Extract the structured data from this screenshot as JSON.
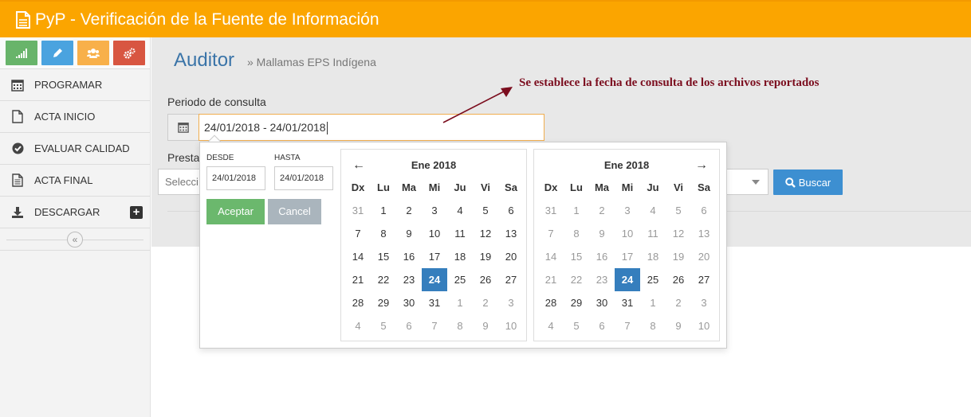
{
  "app": {
    "title": "PyP - Verificación de la Fuente de Información"
  },
  "sidebar": {
    "shortcuts": [
      {
        "icon": "signal-icon",
        "color": "#68b46a"
      },
      {
        "icon": "pencil-icon",
        "color": "#4aa3df"
      },
      {
        "icon": "users-icon",
        "color": "#f8b04a"
      },
      {
        "icon": "cogs-icon",
        "color": "#d85641"
      }
    ],
    "items": [
      {
        "label": "PROGRAMAR",
        "icon": "calendar-icon"
      },
      {
        "label": "ACTA INICIO",
        "icon": "file-icon"
      },
      {
        "label": "EVALUAR CALIDAD",
        "icon": "check-circle-icon"
      },
      {
        "label": "ACTA FINAL",
        "icon": "file-text-icon"
      },
      {
        "label": "DESCARGAR",
        "icon": "download-icon"
      }
    ],
    "collapse_glyph": "«"
  },
  "page": {
    "heading": "Auditor",
    "breadcrumb": "» Mallamas EPS Indígena",
    "period_label": "Periodo de consulta",
    "period_value": "24/01/2018 - 24/01/2018",
    "provider_label": "Presta",
    "provider_placeholder": "Selecci",
    "search_button": "Buscar"
  },
  "annotation": {
    "text": "Se establece la fecha de consulta de los archivos reportados",
    "color": "#7b0d1e"
  },
  "datepicker": {
    "from_label": "DESDE",
    "to_label": "HASTA",
    "from_value": "24/01/2018",
    "to_value": "24/01/2018",
    "apply_label": "Aceptar",
    "cancel_label": "Cancel",
    "weekdays": [
      "Dx",
      "Lu",
      "Ma",
      "Mi",
      "Ju",
      "Vi",
      "Sa"
    ],
    "calendars": [
      {
        "month": "Ene 2018",
        "days": [
          {
            "d": "31",
            "off": true
          },
          {
            "d": "1"
          },
          {
            "d": "2"
          },
          {
            "d": "3"
          },
          {
            "d": "4"
          },
          {
            "d": "5"
          },
          {
            "d": "6"
          },
          {
            "d": "7"
          },
          {
            "d": "8"
          },
          {
            "d": "9"
          },
          {
            "d": "10"
          },
          {
            "d": "11"
          },
          {
            "d": "12"
          },
          {
            "d": "13"
          },
          {
            "d": "14"
          },
          {
            "d": "15"
          },
          {
            "d": "16"
          },
          {
            "d": "17"
          },
          {
            "d": "18"
          },
          {
            "d": "19"
          },
          {
            "d": "20"
          },
          {
            "d": "21"
          },
          {
            "d": "22"
          },
          {
            "d": "23"
          },
          {
            "d": "24",
            "sel": true
          },
          {
            "d": "25"
          },
          {
            "d": "26"
          },
          {
            "d": "27"
          },
          {
            "d": "28"
          },
          {
            "d": "29"
          },
          {
            "d": "30"
          },
          {
            "d": "31"
          },
          {
            "d": "1",
            "off": true
          },
          {
            "d": "2",
            "off": true
          },
          {
            "d": "3",
            "off": true
          },
          {
            "d": "4",
            "off": true
          },
          {
            "d": "5",
            "off": true
          },
          {
            "d": "6",
            "off": true
          },
          {
            "d": "7",
            "off": true
          },
          {
            "d": "8",
            "off": true
          },
          {
            "d": "9",
            "off": true
          },
          {
            "d": "10",
            "off": true
          }
        ]
      },
      {
        "month": "Ene 2018",
        "days": [
          {
            "d": "31",
            "off": true
          },
          {
            "d": "1",
            "off": true
          },
          {
            "d": "2",
            "off": true
          },
          {
            "d": "3",
            "off": true
          },
          {
            "d": "4",
            "off": true
          },
          {
            "d": "5",
            "off": true
          },
          {
            "d": "6",
            "off": true
          },
          {
            "d": "7",
            "off": true
          },
          {
            "d": "8",
            "off": true
          },
          {
            "d": "9",
            "off": true
          },
          {
            "d": "10",
            "off": true
          },
          {
            "d": "11",
            "off": true
          },
          {
            "d": "12",
            "off": true
          },
          {
            "d": "13",
            "off": true
          },
          {
            "d": "14",
            "off": true
          },
          {
            "d": "15",
            "off": true
          },
          {
            "d": "16",
            "off": true
          },
          {
            "d": "17",
            "off": true
          },
          {
            "d": "18",
            "off": true
          },
          {
            "d": "19",
            "off": true
          },
          {
            "d": "20",
            "off": true
          },
          {
            "d": "21",
            "off": true
          },
          {
            "d": "22",
            "off": true
          },
          {
            "d": "23",
            "off": true
          },
          {
            "d": "24",
            "sel": true
          },
          {
            "d": "25"
          },
          {
            "d": "26"
          },
          {
            "d": "27"
          },
          {
            "d": "28"
          },
          {
            "d": "29"
          },
          {
            "d": "30"
          },
          {
            "d": "31"
          },
          {
            "d": "1",
            "off": true
          },
          {
            "d": "2",
            "off": true
          },
          {
            "d": "3",
            "off": true
          },
          {
            "d": "4",
            "off": true
          },
          {
            "d": "5",
            "off": true
          },
          {
            "d": "6",
            "off": true
          },
          {
            "d": "7",
            "off": true
          },
          {
            "d": "8",
            "off": true
          },
          {
            "d": "9",
            "off": true
          },
          {
            "d": "10",
            "off": true
          }
        ]
      }
    ]
  },
  "colors": {
    "topbar": "#fba500",
    "accent_blue": "#357ebd",
    "apply_green": "#6bb86d",
    "cancel_gray": "#aab5bd",
    "input_focus": "#f0ad4e"
  }
}
